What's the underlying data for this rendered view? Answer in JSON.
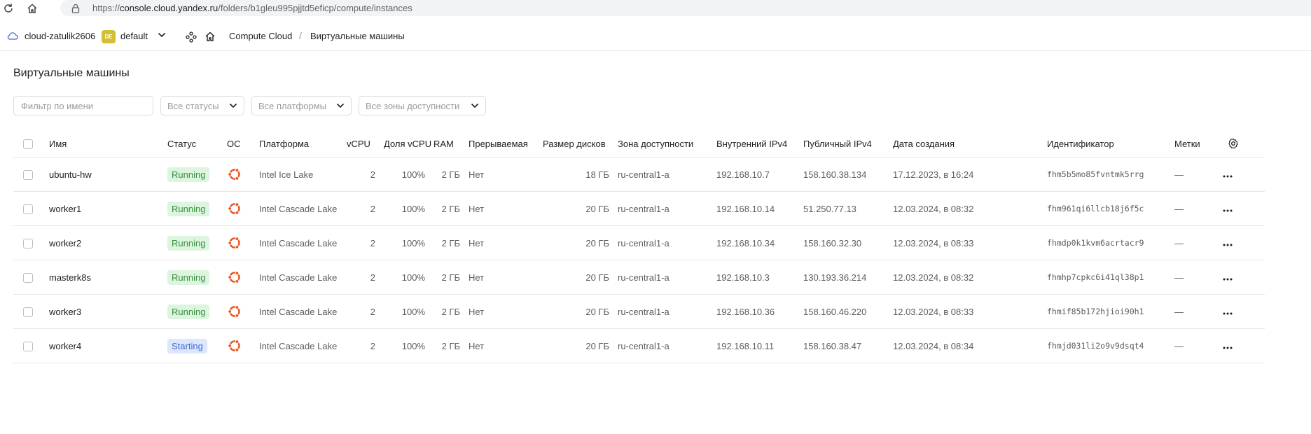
{
  "browser": {
    "url_prefix": "https://",
    "url_domain": "console.cloud.yandex.ru",
    "url_path": "/folders/b1gleu995pjjtd5eficp/compute/instances"
  },
  "header": {
    "cloud_name": "cloud-zatulik2606",
    "folder_badge": "DE",
    "folder_name": "default",
    "breadcrumb_service": "Compute Cloud",
    "breadcrumb_separator": "/",
    "breadcrumb_page": "Виртуальные машины"
  },
  "page": {
    "title": "Виртуальные машины"
  },
  "filters": {
    "name_placeholder": "Фильтр по имени",
    "status": "Все статусы",
    "platform": "Все платформы",
    "zone": "Все зоны доступности"
  },
  "table": {
    "columns": {
      "name": "Имя",
      "status": "Статус",
      "os": "ОС",
      "platform": "Платформа",
      "vcpu": "vCPU",
      "vcpu_share": "Доля vCPU",
      "ram": "RAM",
      "preemptible": "Прерываемая",
      "disk": "Размер дисков",
      "zone": "Зона доступности",
      "ip_internal": "Внутренний IPv4",
      "ip_public": "Публичный IPv4",
      "created": "Дата создания",
      "id": "Идентификатор",
      "labels": "Метки"
    },
    "rows": [
      {
        "name": "ubuntu-hw",
        "status": "Running",
        "platform": "Intel Ice Lake",
        "vcpu": "2",
        "vcpu_share": "100%",
        "ram": "2 ГБ",
        "preemptible": "Нет",
        "disk": "18 ГБ",
        "zone": "ru-central1-a",
        "ip_internal": "192.168.10.7",
        "ip_public": "158.160.38.134",
        "created": "17.12.2023, в 16:24",
        "id": "fhm5b5mo85fvntmk5rrg",
        "labels": "—"
      },
      {
        "name": "worker1",
        "status": "Running",
        "platform": "Intel Cascade Lake",
        "vcpu": "2",
        "vcpu_share": "100%",
        "ram": "2 ГБ",
        "preemptible": "Нет",
        "disk": "20 ГБ",
        "zone": "ru-central1-a",
        "ip_internal": "192.168.10.14",
        "ip_public": "51.250.77.13",
        "created": "12.03.2024, в 08:32",
        "id": "fhm961qi6llcb18j6f5c",
        "labels": "—"
      },
      {
        "name": "worker2",
        "status": "Running",
        "platform": "Intel Cascade Lake",
        "vcpu": "2",
        "vcpu_share": "100%",
        "ram": "2 ГБ",
        "preemptible": "Нет",
        "disk": "20 ГБ",
        "zone": "ru-central1-a",
        "ip_internal": "192.168.10.34",
        "ip_public": "158.160.32.30",
        "created": "12.03.2024, в 08:33",
        "id": "fhmdp0k1kvm6acrtacr9",
        "labels": "—"
      },
      {
        "name": "masterk8s",
        "status": "Running",
        "platform": "Intel Cascade Lake",
        "vcpu": "2",
        "vcpu_share": "100%",
        "ram": "2 ГБ",
        "preemptible": "Нет",
        "disk": "20 ГБ",
        "zone": "ru-central1-a",
        "ip_internal": "192.168.10.3",
        "ip_public": "130.193.36.214",
        "created": "12.03.2024, в 08:32",
        "id": "fhmhp7cpkc6i41ql38p1",
        "labels": "—"
      },
      {
        "name": "worker3",
        "status": "Running",
        "platform": "Intel Cascade Lake",
        "vcpu": "2",
        "vcpu_share": "100%",
        "ram": "2 ГБ",
        "preemptible": "Нет",
        "disk": "20 ГБ",
        "zone": "ru-central1-a",
        "ip_internal": "192.168.10.36",
        "ip_public": "158.160.46.220",
        "created": "12.03.2024, в 08:33",
        "id": "fhmif85b172hjioi90h1",
        "labels": "—"
      },
      {
        "name": "worker4",
        "status": "Starting",
        "platform": "Intel Cascade Lake",
        "vcpu": "2",
        "vcpu_share": "100%",
        "ram": "2 ГБ",
        "preemptible": "Нет",
        "disk": "20 ГБ",
        "zone": "ru-central1-a",
        "ip_internal": "192.168.10.11",
        "ip_public": "158.160.38.47",
        "created": "12.03.2024, в 08:34",
        "id": "fhmjd031li2o9v9dsqt4",
        "labels": "—"
      }
    ]
  },
  "icons": {
    "os": "ubuntu-icon",
    "settings": "gear-icon",
    "row_menu": "more-dots-icon"
  },
  "colors": {
    "running_bg": "#dcf5df",
    "running_text": "#3a8f3f",
    "starting_bg": "#dde7fb",
    "starting_text": "#3d6ad6",
    "ubuntu": "#e95420",
    "folder_badge": "#d4be34"
  }
}
